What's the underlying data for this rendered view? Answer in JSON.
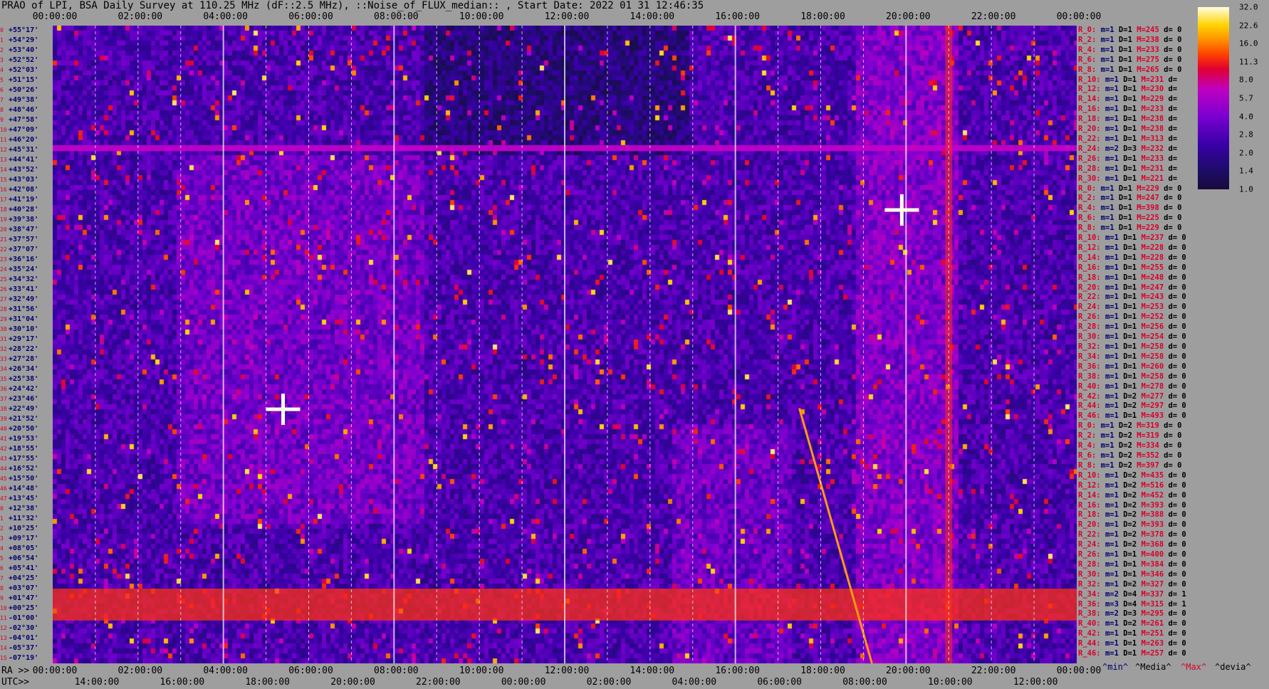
{
  "title": "PRAO of LPI, BSA Daily Survey at 110.25 MHz (dF::2.5 MHz), ::Noise_of_FLUX_median:: , Start Date: 2022 01 31 12:46:35",
  "top_axis": [
    "00:00:00",
    "02:00:00",
    "04:00:00",
    "06:00:00",
    "08:00:00",
    "10:00:00",
    "12:00:00",
    "14:00:00",
    "16:00:00",
    "18:00:00",
    "20:00:00",
    "22:00:00",
    "00:00:00"
  ],
  "ra_row": {
    "label": "RA >>",
    "ticks": [
      "00:00:00",
      "02:00:00",
      "04:00:00",
      "06:00:00",
      "08:00:00",
      "10:00:00",
      "12:00:00",
      "14:00:00",
      "16:00:00",
      "18:00:00",
      "20:00:00",
      "22:00:00",
      "00:00:00"
    ]
  },
  "utc_row": {
    "label": "UTC>>",
    "ticks": [
      "14:00:00",
      "16:00:00",
      "18:00:00",
      "20:00:00",
      "22:00:00",
      "00:00:00",
      "02:00:00",
      "04:00:00",
      "06:00:00",
      "08:00:00",
      "10:00:00",
      "12:00:00"
    ]
  },
  "colorbar": {
    "ticks": [
      "32.0",
      "22.6",
      "16.0",
      "11.3",
      "8.0",
      "5.7",
      "4.0",
      "2.8",
      "2.0",
      "1.4",
      "1.0"
    ]
  },
  "legend": {
    "min": "^min^",
    "median": "^Media^",
    "max": "^Max^",
    "dev": "^devia^"
  },
  "colors": {
    "background": "#9e9e9e",
    "red_label": "#d8002a",
    "blue_label": "#00006e",
    "plot_base": "#1c0c4a"
  },
  "chart_data": {
    "type": "heatmap",
    "title": "PRAO of LPI, BSA Daily Survey at 110.25 MHz (dF::2.5 MHz), ::Noise_of_FLUX_median:: , Start Date: 2022 01 31 12:46:35",
    "xlabel": "RA",
    "ylabel": "",
    "x_range_hours": [
      0,
      24
    ],
    "z_range": [
      1.0,
      32.0
    ],
    "colorscale": "log",
    "beams": [
      {
        "i": "0",
        "dec": "+55°17'"
      },
      {
        "i": "1",
        "dec": "+54°29'"
      },
      {
        "i": "2",
        "dec": "+53°40'"
      },
      {
        "i": "3",
        "dec": "+52°52'"
      },
      {
        "i": "4",
        "dec": "+52°03'"
      },
      {
        "i": "5",
        "dec": "+51°15'"
      },
      {
        "i": "6",
        "dec": "+50°26'"
      },
      {
        "i": "7",
        "dec": "+49°38'"
      },
      {
        "i": "8",
        "dec": "+48°46'"
      },
      {
        "i": "9",
        "dec": "+47°58'"
      },
      {
        "i": "10",
        "dec": "+47°09'"
      },
      {
        "i": "11",
        "dec": "+46°20'"
      },
      {
        "i": "12",
        "dec": "+45°31'"
      },
      {
        "i": "13",
        "dec": "+44°41'"
      },
      {
        "i": "14",
        "dec": "+43°52'"
      },
      {
        "i": "15",
        "dec": "+43°03'"
      },
      {
        "i": "16",
        "dec": "+42°08'"
      },
      {
        "i": "17",
        "dec": "+41°19'"
      },
      {
        "i": "18",
        "dec": "+40°28'"
      },
      {
        "i": "19",
        "dec": "+39°38'"
      },
      {
        "i": "20",
        "dec": "+38°47'"
      },
      {
        "i": "21",
        "dec": "+37°57'"
      },
      {
        "i": "22",
        "dec": "+37°07'"
      },
      {
        "i": "23",
        "dec": "+36°16'"
      },
      {
        "i": "24",
        "dec": "+35°24'"
      },
      {
        "i": "25",
        "dec": "+34°32'"
      },
      {
        "i": "26",
        "dec": "+33°41'"
      },
      {
        "i": "27",
        "dec": "+32°49'"
      },
      {
        "i": "28",
        "dec": "+31°56'"
      },
      {
        "i": "29",
        "dec": "+31°04'"
      },
      {
        "i": "30",
        "dec": "+30°10'"
      },
      {
        "i": "31",
        "dec": "+29°17'"
      },
      {
        "i": "32",
        "dec": "+28°22'"
      },
      {
        "i": "33",
        "dec": "+27°28'"
      },
      {
        "i": "34",
        "dec": "+26°34'"
      },
      {
        "i": "35",
        "dec": "+25°38'"
      },
      {
        "i": "36",
        "dec": "+24°42'"
      },
      {
        "i": "37",
        "dec": "+23°46'"
      },
      {
        "i": "38",
        "dec": "+22°49'"
      },
      {
        "i": "39",
        "dec": "+21°52'"
      },
      {
        "i": "40",
        "dec": "+20°50'"
      },
      {
        "i": "41",
        "dec": "+19°53'"
      },
      {
        "i": "42",
        "dec": "+18°55'"
      },
      {
        "i": "43",
        "dec": "+17°55'"
      },
      {
        "i": "44",
        "dec": "+16°52'"
      },
      {
        "i": "45",
        "dec": "+15°50'"
      },
      {
        "i": "46",
        "dec": "+14°48'"
      },
      {
        "i": "47",
        "dec": "+13°45'"
      },
      {
        "i": "0",
        "dec": "+12°38'"
      },
      {
        "i": "1",
        "dec": "+11°32'"
      },
      {
        "i": "2",
        "dec": "+10°25'"
      },
      {
        "i": "3",
        "dec": "+09°17'"
      },
      {
        "i": "4",
        "dec": "+08°05'"
      },
      {
        "i": "5",
        "dec": "+06°54'"
      },
      {
        "i": "6",
        "dec": "+05°41'"
      },
      {
        "i": "7",
        "dec": "+04°25'"
      },
      {
        "i": "8",
        "dec": "+03°07'"
      },
      {
        "i": "9",
        "dec": "+01°47'"
      },
      {
        "i": "10",
        "dec": "+00°25'"
      },
      {
        "i": "11",
        "dec": "-01°00'"
      },
      {
        "i": "12",
        "dec": "-02°30'"
      },
      {
        "i": "13",
        "dec": "-04°01'"
      },
      {
        "i": "14",
        "dec": "-05°37'"
      },
      {
        "i": "15",
        "dec": "-07°19'"
      }
    ],
    "stats": [
      {
        "r": "R_0:",
        "m": "m=1",
        "d": "D=1",
        "M": "M=245",
        "dv": "d= 0"
      },
      {
        "r": "R_2:",
        "m": "m=1",
        "d": "D=1",
        "M": "M=238",
        "dv": "d= 0"
      },
      {
        "r": "R_4:",
        "m": "m=1",
        "d": "D=1",
        "M": "M=233",
        "dv": "d= 0"
      },
      {
        "r": "R_6:",
        "m": "m=1",
        "d": "D=1",
        "M": "M=275",
        "dv": "d= 0"
      },
      {
        "r": "R_8:",
        "m": "m=1",
        "d": "D=1",
        "M": "M=265",
        "dv": "d= 0"
      },
      {
        "r": "R_10:",
        "m": "m=1",
        "d": "D=1",
        "M": "M=231",
        "dv": "d="
      },
      {
        "r": "R_12:",
        "m": "m=1",
        "d": "D=1",
        "M": "M=230",
        "dv": "d="
      },
      {
        "r": "R_14:",
        "m": "m=1",
        "d": "D=1",
        "M": "M=229",
        "dv": "d="
      },
      {
        "r": "R_16:",
        "m": "m=1",
        "d": "D=1",
        "M": "M=233",
        "dv": "d="
      },
      {
        "r": "R_18:",
        "m": "m=1",
        "d": "D=1",
        "M": "M=238",
        "dv": "d="
      },
      {
        "r": "R_20:",
        "m": "m=1",
        "d": "D=1",
        "M": "M=238",
        "dv": "d="
      },
      {
        "r": "R_22:",
        "m": "m=1",
        "d": "D=1",
        "M": "M=313",
        "dv": "d="
      },
      {
        "r": "R_24:",
        "m": "m=2",
        "d": "D=3",
        "M": "M=232",
        "dv": "d="
      },
      {
        "r": "R_26:",
        "m": "m=1",
        "d": "D=1",
        "M": "M=233",
        "dv": "d="
      },
      {
        "r": "R_28:",
        "m": "m=1",
        "d": "D=1",
        "M": "M=231",
        "dv": "d="
      },
      {
        "r": "R_30:",
        "m": "m=1",
        "d": "D=1",
        "M": "M=221",
        "dv": "d="
      },
      {
        "r": "R_0:",
        "m": "m=1",
        "d": "D=1",
        "M": "M=229",
        "dv": "d= 0"
      },
      {
        "r": "R_2:",
        "m": "m=1",
        "d": "D=1",
        "M": "M=247",
        "dv": "d= 0"
      },
      {
        "r": "R_4:",
        "m": "m=1",
        "d": "D=1",
        "M": "M=398",
        "dv": "d= 0"
      },
      {
        "r": "R_6:",
        "m": "m=1",
        "d": "D=1",
        "M": "M=225",
        "dv": "d= 0"
      },
      {
        "r": "R_8:",
        "m": "m=1",
        "d": "D=1",
        "M": "M=229",
        "dv": "d= 0"
      },
      {
        "r": "R_10:",
        "m": "m=1",
        "d": "D=1",
        "M": "M=237",
        "dv": "d= 0"
      },
      {
        "r": "R_12:",
        "m": "m=1",
        "d": "D=1",
        "M": "M=228",
        "dv": "d= 0"
      },
      {
        "r": "R_14:",
        "m": "m=1",
        "d": "D=1",
        "M": "M=228",
        "dv": "d= 0"
      },
      {
        "r": "R_16:",
        "m": "m=1",
        "d": "D=1",
        "M": "M=255",
        "dv": "d= 0"
      },
      {
        "r": "R_18:",
        "m": "m=1",
        "d": "D=1",
        "M": "M=248",
        "dv": "d= 0"
      },
      {
        "r": "R_20:",
        "m": "m=1",
        "d": "D=1",
        "M": "M=247",
        "dv": "d= 0"
      },
      {
        "r": "R_22:",
        "m": "m=1",
        "d": "D=1",
        "M": "M=243",
        "dv": "d= 0"
      },
      {
        "r": "R_24:",
        "m": "m=1",
        "d": "D=1",
        "M": "M=253",
        "dv": "d= 0"
      },
      {
        "r": "R_26:",
        "m": "m=1",
        "d": "D=1",
        "M": "M=252",
        "dv": "d= 0"
      },
      {
        "r": "R_28:",
        "m": "m=1",
        "d": "D=1",
        "M": "M=256",
        "dv": "d= 0"
      },
      {
        "r": "R_30:",
        "m": "m=1",
        "d": "D=1",
        "M": "M=254",
        "dv": "d= 0"
      },
      {
        "r": "R_32:",
        "m": "m=1",
        "d": "D=1",
        "M": "M=258",
        "dv": "d= 0"
      },
      {
        "r": "R_34:",
        "m": "m=1",
        "d": "D=1",
        "M": "M=258",
        "dv": "d= 0"
      },
      {
        "r": "R_36:",
        "m": "m=1",
        "d": "D=1",
        "M": "M=260",
        "dv": "d= 0"
      },
      {
        "r": "R_38:",
        "m": "m=1",
        "d": "D=1",
        "M": "M=258",
        "dv": "d= 0"
      },
      {
        "r": "R_40:",
        "m": "m=1",
        "d": "D=1",
        "M": "M=278",
        "dv": "d= 0"
      },
      {
        "r": "R_42:",
        "m": "m=1",
        "d": "D=2",
        "M": "M=277",
        "dv": "d= 0"
      },
      {
        "r": "R_44:",
        "m": "m=1",
        "d": "D=2",
        "M": "M=297",
        "dv": "d= 0"
      },
      {
        "r": "R_46:",
        "m": "m=1",
        "d": "D=1",
        "M": "M=493",
        "dv": "d= 0"
      },
      {
        "r": "R_0:",
        "m": "m=1",
        "d": "D=2",
        "M": "M=319",
        "dv": "d= 0"
      },
      {
        "r": "R_2:",
        "m": "m=1",
        "d": "D=2",
        "M": "M=319",
        "dv": "d= 0"
      },
      {
        "r": "R_4:",
        "m": "m=1",
        "d": "D=2",
        "M": "M=334",
        "dv": "d= 0"
      },
      {
        "r": "R_6:",
        "m": "m=1",
        "d": "D=2",
        "M": "M=352",
        "dv": "d= 0"
      },
      {
        "r": "R_8:",
        "m": "m=1",
        "d": "D=2",
        "M": "M=397",
        "dv": "d= 0"
      },
      {
        "r": "R_10:",
        "m": "m=1",
        "d": "D=2",
        "M": "M=435",
        "dv": "d= 0"
      },
      {
        "r": "R_12:",
        "m": "m=1",
        "d": "D=2",
        "M": "M=516",
        "dv": "d= 0"
      },
      {
        "r": "R_14:",
        "m": "m=1",
        "d": "D=2",
        "M": "M=452",
        "dv": "d= 0"
      },
      {
        "r": "R_16:",
        "m": "m=1",
        "d": "D=2",
        "M": "M=393",
        "dv": "d= 0"
      },
      {
        "r": "R_18:",
        "m": "m=1",
        "d": "D=2",
        "M": "M=388",
        "dv": "d= 0"
      },
      {
        "r": "R_20:",
        "m": "m=1",
        "d": "D=2",
        "M": "M=393",
        "dv": "d= 0"
      },
      {
        "r": "R_22:",
        "m": "m=1",
        "d": "D=2",
        "M": "M=378",
        "dv": "d= 0"
      },
      {
        "r": "R_24:",
        "m": "m=1",
        "d": "D=2",
        "M": "M=368",
        "dv": "d= 0"
      },
      {
        "r": "R_26:",
        "m": "m=1",
        "d": "D=1",
        "M": "M=400",
        "dv": "d= 0"
      },
      {
        "r": "R_28:",
        "m": "m=1",
        "d": "D=1",
        "M": "M=384",
        "dv": "d= 0"
      },
      {
        "r": "R_30:",
        "m": "m=1",
        "d": "D=1",
        "M": "M=346",
        "dv": "d= 0"
      },
      {
        "r": "R_32:",
        "m": "m=1",
        "d": "D=2",
        "M": "M=327",
        "dv": "d= 0"
      },
      {
        "r": "R_34:",
        "m": "m=2",
        "d": "D=4",
        "M": "M=337",
        "dv": "d= 1"
      },
      {
        "r": "R_36:",
        "m": "m=3",
        "d": "D=4",
        "M": "M=315",
        "dv": "d= 1"
      },
      {
        "r": "R_38:",
        "m": "m=2",
        "d": "D=3",
        "M": "M=295",
        "dv": "d= 0"
      },
      {
        "r": "R_40:",
        "m": "m=1",
        "d": "D=2",
        "M": "M=261",
        "dv": "d= 0"
      },
      {
        "r": "R_42:",
        "m": "m=1",
        "d": "D=1",
        "M": "M=251",
        "dv": "d= 0"
      },
      {
        "r": "R_44:",
        "m": "m=1",
        "d": "D=1",
        "M": "M=263",
        "dv": "d= 0"
      },
      {
        "r": "R_46:",
        "m": "m=1",
        "d": "D=1",
        "M": "M=257",
        "dv": "d= 0"
      }
    ],
    "features": [
      {
        "kind": "horizontal_band",
        "dec": "+45°31'",
        "level": 4.0
      },
      {
        "kind": "horizontal_band",
        "dec": "+00°25'",
        "level": 8.0
      },
      {
        "kind": "bright_source",
        "ra_hours": 19.9,
        "dec": "+40°28'",
        "level": 32.0
      },
      {
        "kind": "bright_source",
        "ra_hours": 5.4,
        "dec": "+22°49'",
        "level": 32.0
      },
      {
        "kind": "vertical_column",
        "ra_hours": 21.0,
        "level": 8.0
      },
      {
        "kind": "diagonal_track",
        "ra_start": 17.5,
        "ra_end": 19.2,
        "level": 11.3
      }
    ]
  }
}
